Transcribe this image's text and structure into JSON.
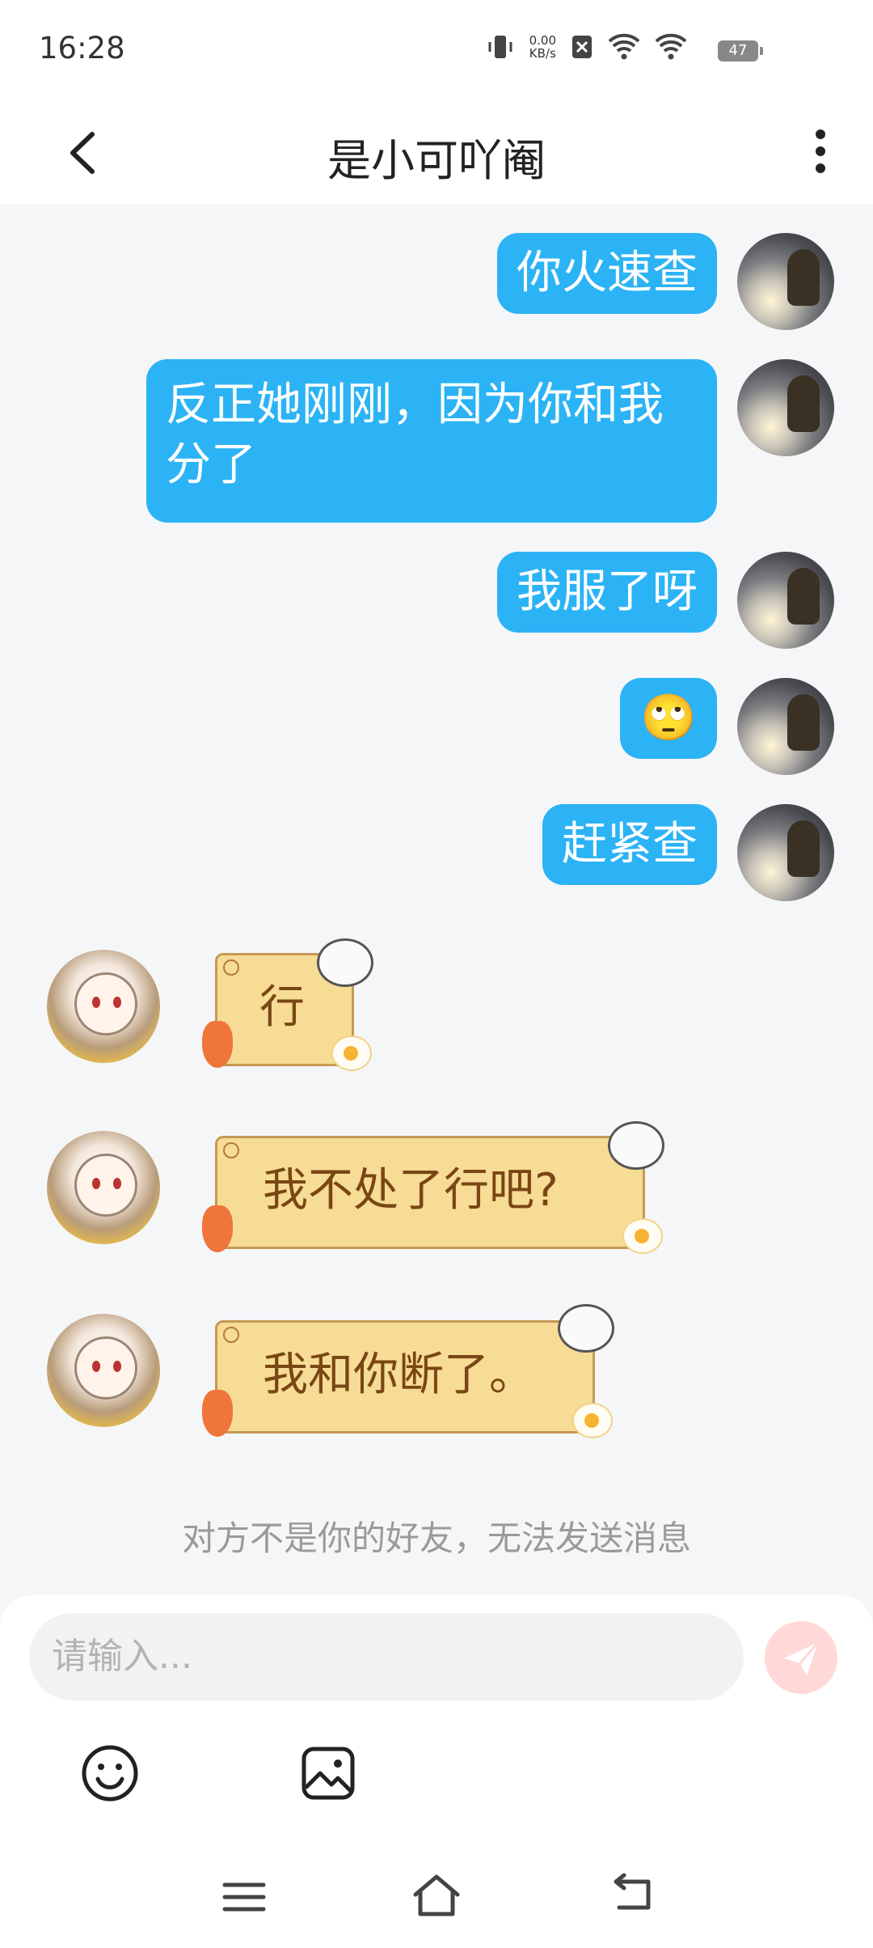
{
  "status_bar": {
    "time": "16:28",
    "net_speed_value": "0.00",
    "net_speed_unit": "KB/s",
    "battery": "47"
  },
  "header": {
    "title": "是小可吖阉"
  },
  "messages_out": [
    {
      "text": "你火速查"
    },
    {
      "text": "反正她刚刚，因为你和我分了"
    },
    {
      "text": "我服了呀"
    },
    {
      "text": "🙄"
    },
    {
      "text": "赶紧查"
    }
  ],
  "messages_in": [
    {
      "text": "行"
    },
    {
      "text": "我不处了行吧?"
    },
    {
      "text": "我和你断了。"
    }
  ],
  "notice": "对方不是你的好友，无法发送消息",
  "input": {
    "placeholder": "请输入..."
  },
  "icons": {
    "back": "chevron-left-icon",
    "more": "more-vertical-icon",
    "send": "send-icon",
    "emoji": "emoji-icon",
    "image": "image-icon",
    "nav": [
      "menu-icon",
      "home-icon",
      "back-icon"
    ]
  },
  "colors": {
    "bubble_out": "#2bb3f5",
    "bubble_in": "#f6dc95",
    "bubble_in_text": "#7a4614",
    "send_disabled": "#ffd9d7"
  }
}
